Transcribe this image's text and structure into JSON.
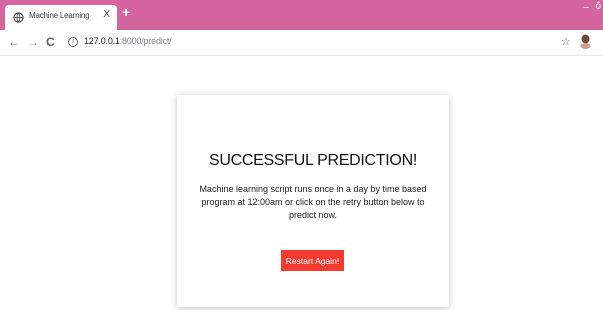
{
  "browser": {
    "tab": {
      "title": "Machine Learning",
      "close_label": "X"
    },
    "new_tab_label": "+",
    "window": {
      "minimize_label": "–",
      "restore_label": "ô"
    },
    "nav": {
      "back_label": "←",
      "forward_label": "→",
      "reload_label": "C"
    },
    "address": {
      "host": "127.0.0.1",
      "path": ":8000/predict/"
    },
    "icons": [
      "globe-icon",
      "info-icon",
      "star-icon",
      "profile-icon"
    ]
  },
  "page": {
    "title": "SUCCESSFUL PREDICTION!",
    "message": "Machine learning script runs once in a day by time based program at 12:00am or click on the retry button below to predict now.",
    "restart_button_label": "Restart Again!"
  },
  "colors": {
    "titlebar": "#d6649e",
    "button": "#f23a2f"
  }
}
